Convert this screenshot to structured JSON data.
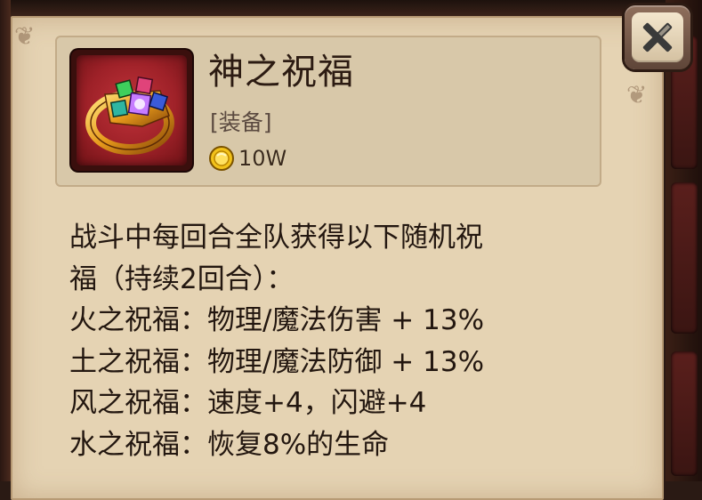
{
  "item": {
    "name": "神之祝福",
    "type": "[装备]",
    "price": "10W",
    "icon": "jeweled-ring-icon",
    "currency_icon": "gold-coin-icon"
  },
  "description": {
    "lines": [
      "战斗中每回合全队获得以下随机祝",
      "福（持续2回合）：",
      "火之祝福：物理/魔法伤害 + 13%",
      "土之祝福：物理/魔法防御 + 13%",
      "风之祝福：速度+4，闪避+4",
      "水之祝福：恢复8%的生命"
    ]
  },
  "close_button": {
    "icon": "close-icon"
  },
  "colors": {
    "parchment": "#e5d3b3",
    "frame_red": "#9e2128",
    "text_dark": "#231710",
    "coin_gold": "#f2c21a"
  }
}
